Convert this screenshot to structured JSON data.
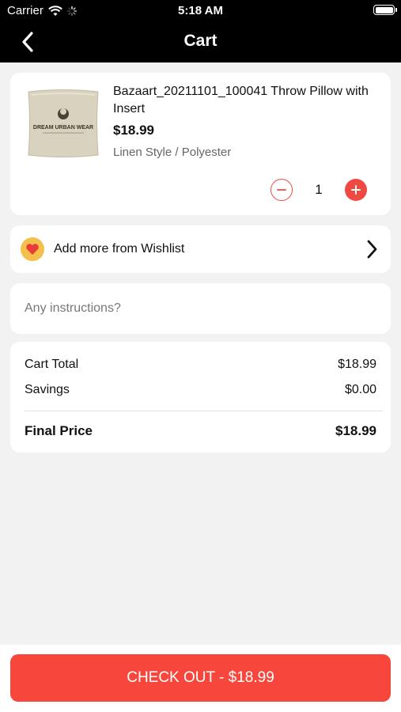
{
  "status_bar": {
    "carrier": "Carrier",
    "time": "5:18 AM"
  },
  "nav": {
    "title": "Cart",
    "back_icon": "chevron-left-icon"
  },
  "cart_item": {
    "name": "Bazaart_20211101_100041 Throw Pillow with Insert",
    "price": "$18.99",
    "variant": "Linen Style / Polyester",
    "quantity": "1",
    "thumbnail_text": "DREAM URBAN WEAR"
  },
  "wishlist": {
    "label": "Add more from Wishlist",
    "icon": "heart-icon"
  },
  "instructions": {
    "placeholder": "Any instructions?",
    "value": ""
  },
  "summary": {
    "cart_total_label": "Cart Total",
    "cart_total_value": "$18.99",
    "savings_label": "Savings",
    "savings_value": "$0.00",
    "final_price_label": "Final Price",
    "final_price_value": "$18.99"
  },
  "checkout": {
    "label": "CHECK OUT - $18.99"
  },
  "colors": {
    "accent": "#f7473d",
    "nav_bg": "#000000",
    "page_bg": "#f2f2f2",
    "heart_bg": "#f4c04b"
  }
}
